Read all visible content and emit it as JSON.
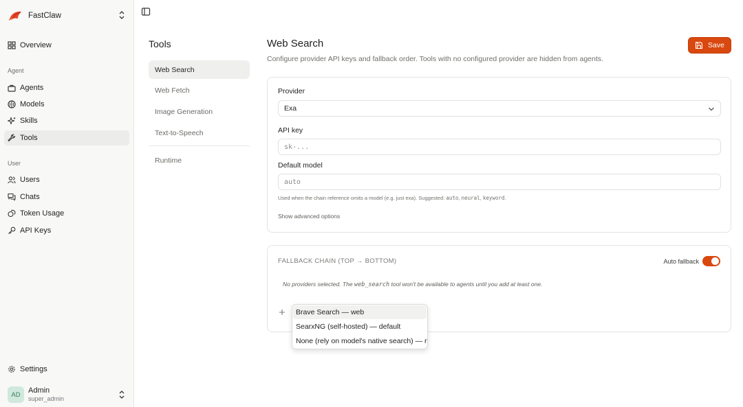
{
  "app": {
    "name": "FastClaw"
  },
  "sidebar": {
    "overview": "Overview",
    "agent_group": "Agent",
    "agent_items": [
      {
        "label": "Agents",
        "icon": "briefcase-icon"
      },
      {
        "label": "Models",
        "icon": "brain-icon"
      },
      {
        "label": "Skills",
        "icon": "sparkles-icon"
      },
      {
        "label": "Tools",
        "icon": "wrench-icon"
      }
    ],
    "user_group": "User",
    "user_items": [
      {
        "label": "Users",
        "icon": "users-icon"
      },
      {
        "label": "Chats",
        "icon": "chat-icon"
      },
      {
        "label": "Token Usage",
        "icon": "coins-icon"
      },
      {
        "label": "API Keys",
        "icon": "key-icon"
      }
    ],
    "settings": "Settings",
    "user": {
      "initials": "AD",
      "name": "Admin",
      "role": "super_admin"
    }
  },
  "tools_nav": {
    "title": "Tools",
    "items": [
      "Web Search",
      "Web Fetch",
      "Image Generation",
      "Text-to-Speech"
    ],
    "runtime": "Runtime"
  },
  "main": {
    "title": "Web Search",
    "description": "Configure provider API keys and fallback order. Tools with no configured provider are hidden from agents.",
    "save_label": "Save",
    "provider_label": "Provider",
    "provider_value": "Exa",
    "api_key_label": "API key",
    "api_key_placeholder": "sk-...",
    "default_model_label": "Default model",
    "default_model_placeholder": "auto",
    "hint_prefix": "Used when the chain reference omits a model (e.g. just ",
    "hint_example": "exa",
    "hint_mid": "). Suggested: ",
    "hint_s1": "auto",
    "hint_s2": "neural",
    "hint_s3": "keyword",
    "hint_end": ".",
    "advanced_link": "Show advanced options",
    "chain_title": "FALLBACK CHAIN (TOP → BOTTOM)",
    "auto_fallback_label": "Auto fallback",
    "auto_fallback_on": true,
    "empty_prefix": "No providers selected. The ",
    "empty_code": "web_search",
    "empty_suffix": " tool won't be available to agents until you add at least one."
  },
  "dropdown": {
    "options": [
      "Brave Search — web",
      "SearxNG (self-hosted) — default",
      "None (rely on model's native search) — native"
    ]
  },
  "colors": {
    "accent": "#d9480f",
    "sidebar_bg": "#f8f8f7"
  }
}
